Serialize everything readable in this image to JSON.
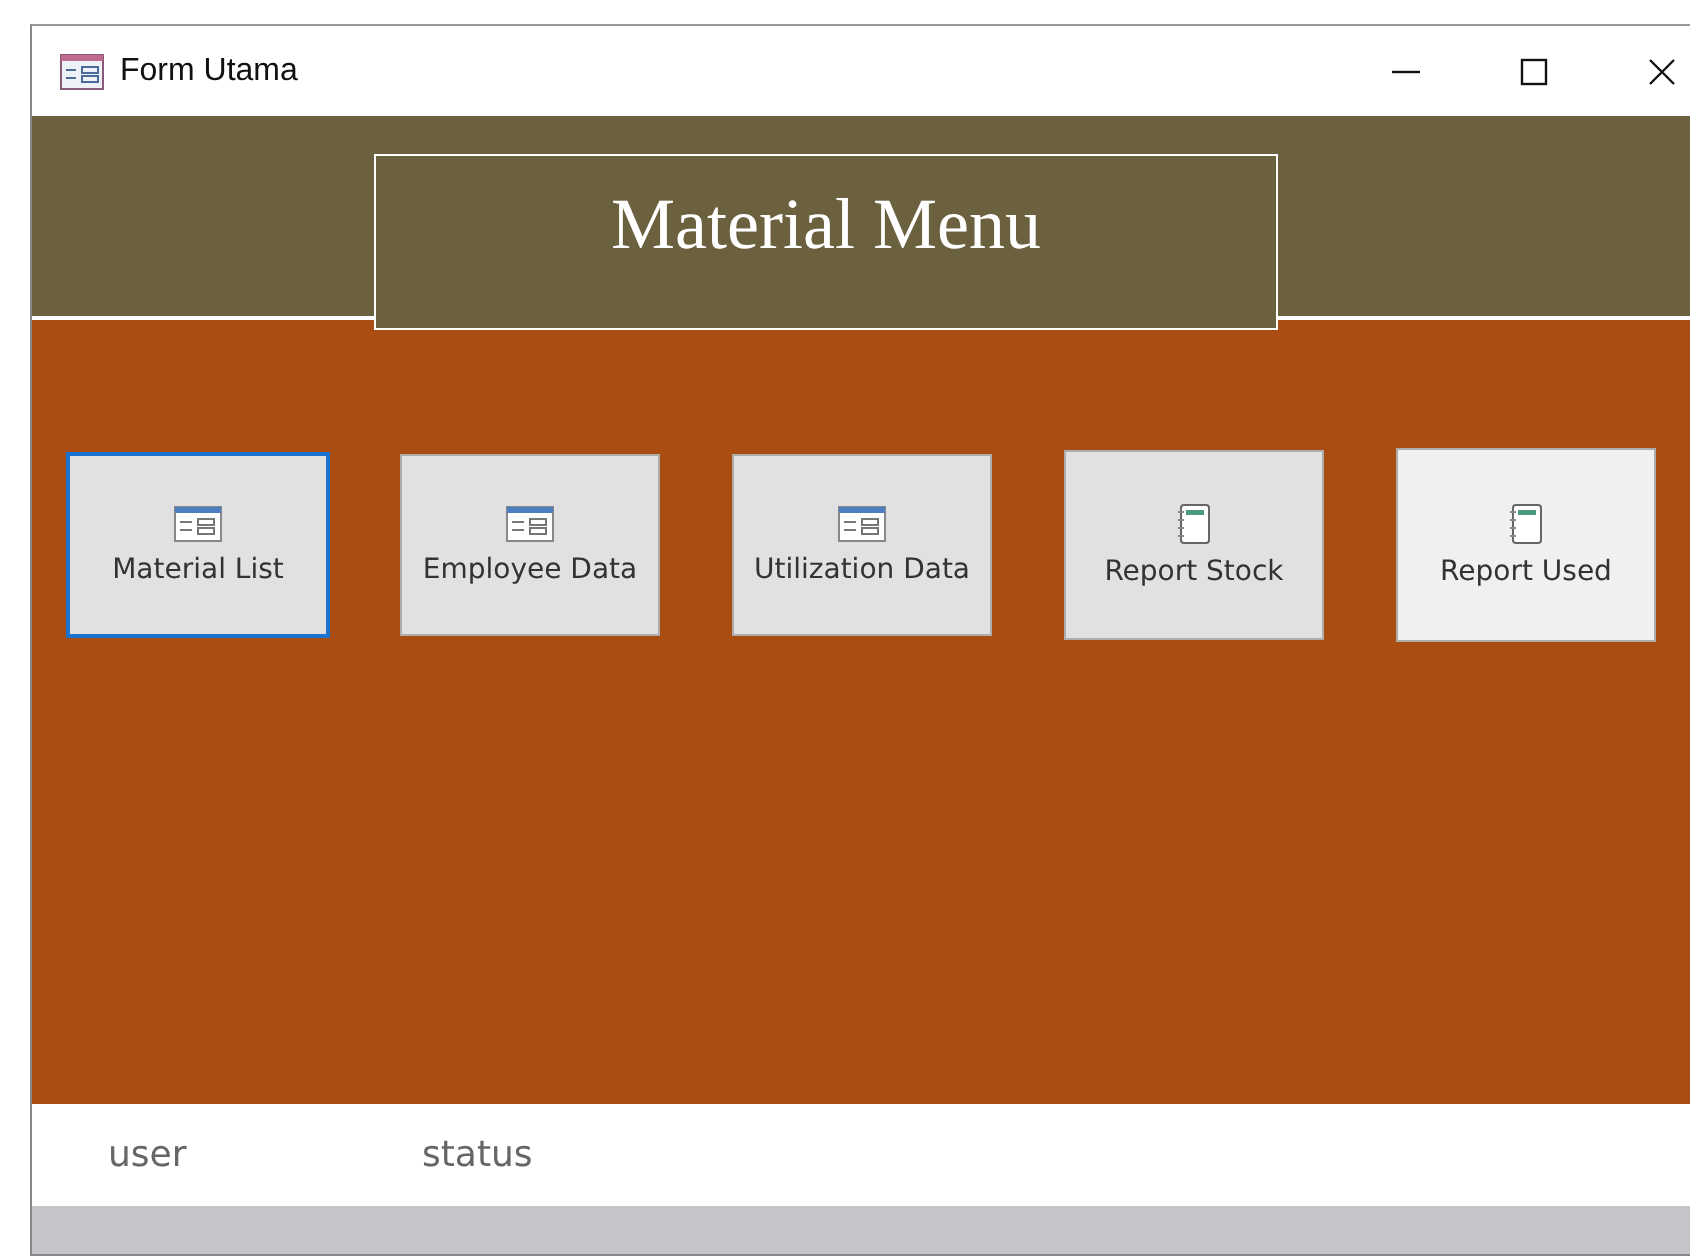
{
  "window": {
    "title": "Form Utama"
  },
  "header": {
    "title": "Material Menu"
  },
  "buttons": [
    {
      "label": "Material List",
      "kind": "form",
      "selected": true,
      "hovered": false
    },
    {
      "label": "Employee Data",
      "kind": "form",
      "selected": false,
      "hovered": false
    },
    {
      "label": "Utilization Data",
      "kind": "form",
      "selected": false,
      "hovered": false
    },
    {
      "label": "Report Stock",
      "kind": "report",
      "selected": false,
      "hovered": false
    },
    {
      "label": "Report Used",
      "kind": "report",
      "selected": false,
      "hovered": true
    }
  ],
  "footer": {
    "fields": [
      "user",
      "status"
    ]
  }
}
